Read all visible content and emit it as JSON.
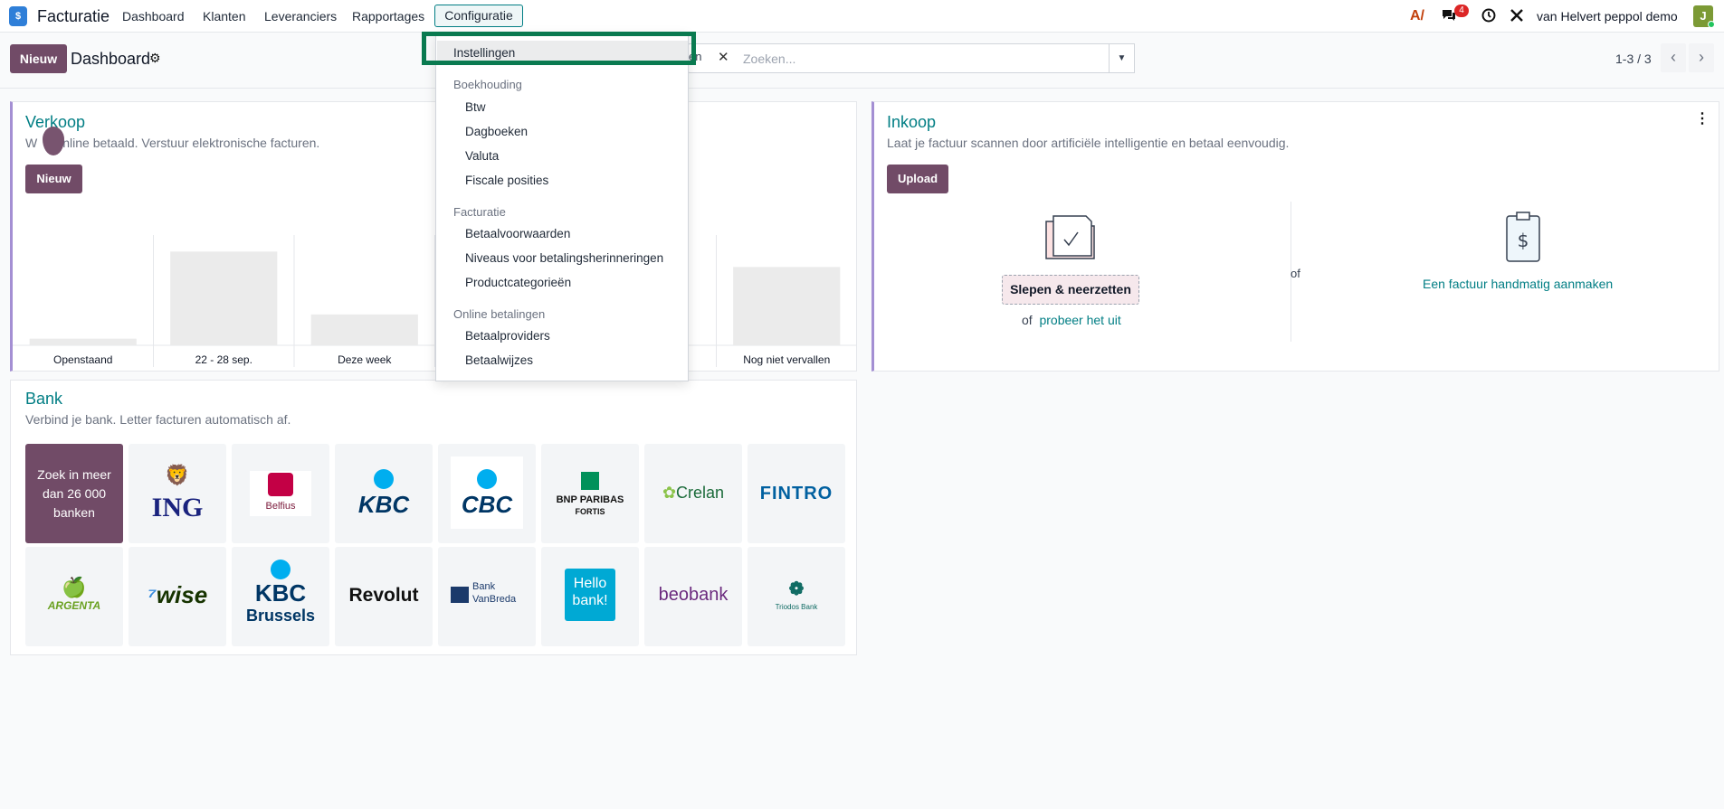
{
  "topbar": {
    "app_icon": "invoice-app-icon",
    "app_name": "Facturatie",
    "menu": [
      "Dashboard",
      "Klanten",
      "Leveranciers",
      "Rapportages",
      "Configuratie"
    ],
    "messages_badge": "4",
    "company": "van Helvert peppol demo",
    "avatar_letter": "J"
  },
  "control": {
    "new_label": "Nieuw",
    "title": "Dashboard",
    "search_facet": "en",
    "search_placeholder": "Zoeken...",
    "pager": "1-3 / 3",
    "prev": "‹",
    "next": "›"
  },
  "verkoop": {
    "title": "Verkoop",
    "subtitle_start": "W",
    "subtitle_end": "nline betaald. Verstuur elektronische facturen.",
    "new_label": "Nieuw"
  },
  "chart_data": {
    "type": "bar",
    "categories": [
      "Openstaand",
      "22 - 28 sep.",
      "Deze week",
      "",
      "",
      "Nog niet vervallen"
    ],
    "values": [
      6,
      85,
      28,
      0,
      0,
      71
    ],
    "ylim": [
      0,
      100
    ],
    "grid": true
  },
  "inkoop": {
    "title": "Inkoop",
    "subtitle": "Laat je factuur scannen door artificiële intelligentie en betaal eenvoudig.",
    "upload_label": "Upload",
    "dragdrop": "Slepen & neerzetten",
    "or_label": "of",
    "try_link": "probeer het uit",
    "middle_or": "of",
    "manual_link": "Een factuur handmatig aanmaken"
  },
  "bank": {
    "title": "Bank",
    "subtitle": "Verbind je bank. Letter facturen automatisch af.",
    "search_tile": "Zoek in meer dan 26 000 banken",
    "banks_row1": [
      "ING",
      "Belfius",
      "KBC",
      "CBC",
      "BNP PARIBAS",
      "Crelan",
      "FINTRO"
    ],
    "bnp_sub": "FORTIS",
    "banks_row2": [
      "ARGENTA",
      "wise",
      "KBC",
      "Brussels",
      "Revolut",
      "Bank",
      "VanBreda",
      "Hello",
      "bank!",
      "beobank",
      "Triodos Bank"
    ]
  },
  "dropdown": {
    "settings": "Instellingen",
    "sections": [
      {
        "header": "Boekhouding",
        "items": [
          "Btw",
          "Dagboeken",
          "Valuta",
          "Fiscale posities"
        ]
      },
      {
        "header": "Facturatie",
        "items": [
          "Betaalvoorwaarden",
          "Niveaus voor betalingsherinneringen",
          "Productcategorieën"
        ]
      },
      {
        "header": "Online betalingen",
        "items": [
          "Betaalproviders",
          "Betaalwijzes"
        ]
      }
    ]
  },
  "colors": {
    "primary": "#714b67",
    "accent": "#017e84",
    "highlight": "#0a7a50"
  }
}
